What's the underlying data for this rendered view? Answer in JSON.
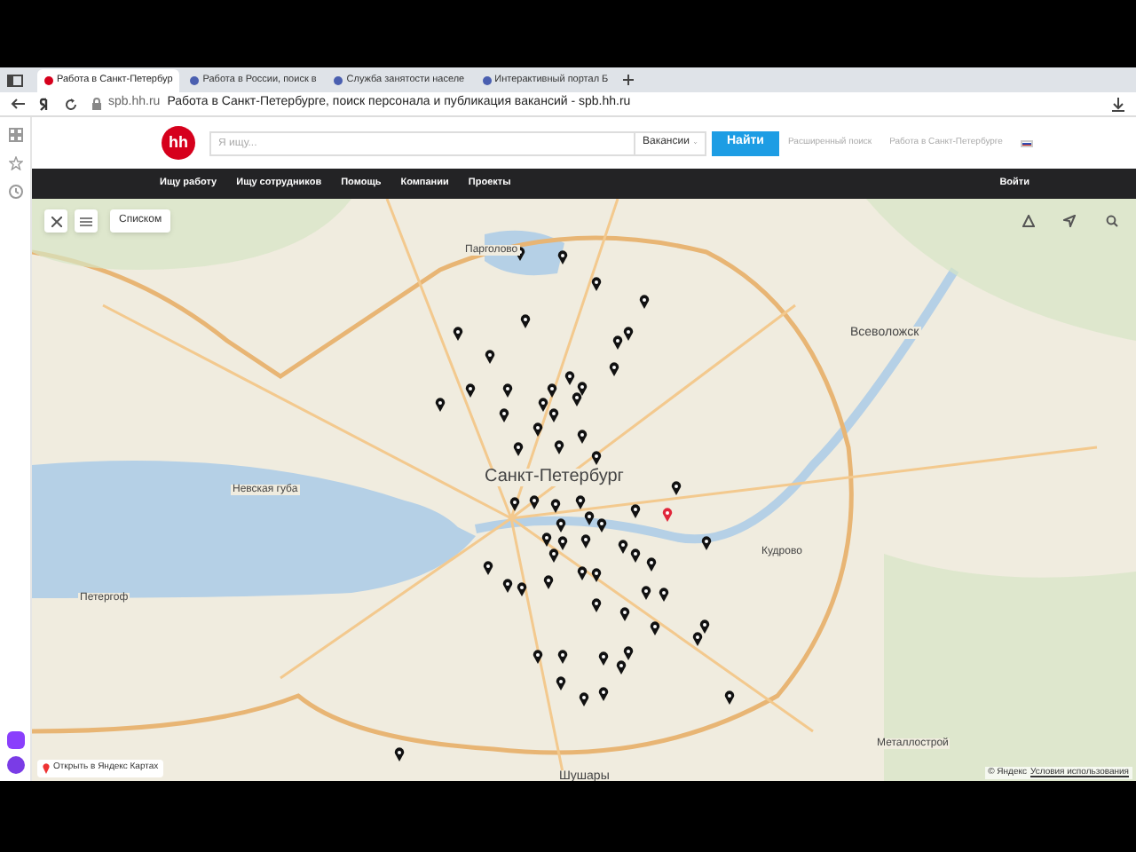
{
  "browser": {
    "tabs": [
      {
        "title": "Работа в Санкт-Петербур",
        "selected": true
      },
      {
        "title": "Работа в России, поиск в",
        "selected": false
      },
      {
        "title": "Служба занятости населе",
        "selected": false
      },
      {
        "title": "Интерактивный портал Б",
        "selected": false
      }
    ],
    "address": {
      "domain": "spb.hh.ru",
      "title": "Работа в Санкт-Петербурге, поиск персонала и публикация вакансий - spb.hh.ru"
    }
  },
  "header": {
    "logo": "hh",
    "search": {
      "placeholder": "Я ищу..."
    },
    "scope": "Вакансии",
    "search_button": "Найти",
    "advanced_search": "Расширенный поиск",
    "region_link": "Работа в Санкт-Петербурге"
  },
  "nav": {
    "items": [
      "Ищу работу",
      "Ищу сотрудников",
      "Помощь",
      "Компании",
      "Проекты"
    ],
    "login": "Войти"
  },
  "map": {
    "list_button": "Списком",
    "labels": [
      "Парголово",
      "Санкт-Петербург",
      "Невская губа",
      "Петергоф",
      "Всеволожск",
      "Кудрово",
      "Шушары",
      "Металлострой"
    ],
    "open_link": "Открыть в Яндекс Картах",
    "copyright": "© Яндекс",
    "terms": "Условия использования"
  }
}
